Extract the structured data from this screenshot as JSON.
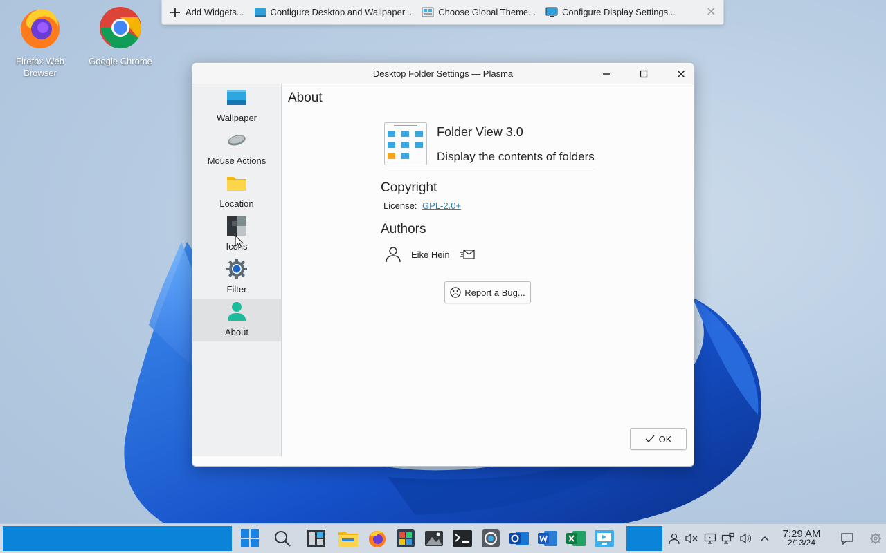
{
  "desktop": {
    "icons": [
      {
        "label": "Firefox Web Browser"
      },
      {
        "label": "Google Chrome"
      }
    ]
  },
  "toolbar": {
    "add_widgets": "Add Widgets...",
    "configure_desktop": "Configure Desktop and Wallpaper...",
    "global_theme": "Choose Global Theme...",
    "display_settings": "Configure Display Settings...",
    "close_icon": "✕"
  },
  "dialog": {
    "title": "Desktop Folder Settings — Plasma",
    "sidebar": {
      "items": [
        {
          "label": "Wallpaper",
          "icon": "wallpaper-icon"
        },
        {
          "label": "Mouse Actions",
          "icon": "mouse-icon"
        },
        {
          "label": "Location",
          "icon": "folder-icon"
        },
        {
          "label": "Icons",
          "icon": "icons-icon"
        },
        {
          "label": "Filter",
          "icon": "filter-gear-icon"
        },
        {
          "label": "About",
          "icon": "about-person-icon"
        }
      ],
      "active": "About"
    },
    "page_title": "About",
    "about": {
      "app_name": "Folder View 3.0",
      "app_description": "Display the contents of folders",
      "copyright_heading": "Copyright",
      "license_label": "License:",
      "license_value": "GPL-2.0+",
      "authors_heading": "Authors",
      "author_name": "Eike Hein",
      "report_bug_label": "Report a Bug..."
    },
    "ok_label": "OK"
  },
  "taskbar": {
    "clock_time": "7:29 AM",
    "clock_date": "2/13/24"
  },
  "colors": {
    "accent": "#0a84d8",
    "link": "#2980b9",
    "dialog_bg": "#fcfcfc",
    "sidebar_bg": "#eff0f1"
  }
}
